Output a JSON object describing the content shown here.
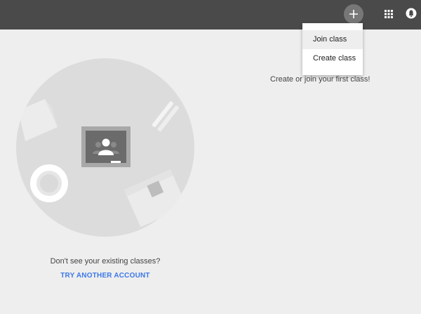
{
  "topbar": {
    "add_icon": "plus-icon",
    "apps_icon": "apps-grid-icon",
    "account_icon": "account-icon"
  },
  "menu": {
    "items": [
      {
        "label": "Join class",
        "active": true
      },
      {
        "label": "Create class",
        "active": false
      }
    ]
  },
  "main": {
    "cta_text": "Create or join your first class!",
    "prompt_text": "Don't see your existing classes?",
    "try_link": "TRY ANOTHER ACCOUNT"
  },
  "colors": {
    "topbar": "#4a4a4a",
    "background": "#eeeeee",
    "link": "#3b78e7"
  }
}
